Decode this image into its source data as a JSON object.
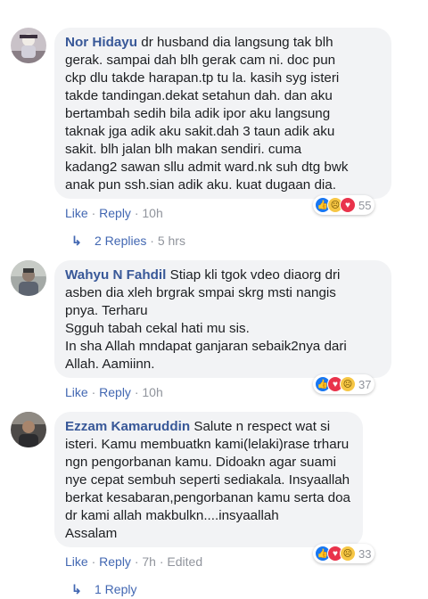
{
  "comments": [
    {
      "author": "Nor Hidayu",
      "lines": [
        "dr husband dia langsung tak blh",
        "gerak. sampai dah blh gerak cam ni. doc pun",
        "ckp dlu takde harapan.tp tu la. kasih syg isteri",
        "takde tandingan.dekat setahun dah. dan aku",
        "bertambah sedih bila adik ipor aku langsung",
        "taknak jga adik aku sakit.dah 3 taun adik aku",
        "sakit. blh jalan blh makan sendiri. cuma",
        "kadang2 sawan sllu admit ward.nk suh dtg bwk",
        "anak pun ssh.sian adik aku. kuat dugaan dia."
      ],
      "actions": {
        "like": "Like",
        "reply": "Reply",
        "time": "10h"
      },
      "reactions": {
        "count": "55",
        "types": [
          "like-icon",
          "sad-icon",
          "love-icon"
        ]
      },
      "replies": {
        "label": "2 Replies",
        "time": "5 hrs"
      }
    },
    {
      "author": "Wahyu N Fahdil",
      "lines": [
        "Stiap kli tgok vdeo diaorg dri",
        "asben dia xleh brgrak smpai skrg msti nangis",
        "pnya. Terharu",
        "Sgguh tabah cekal hati mu sis.",
        "In sha Allah mndapat ganjaran sebaik2nya dari",
        "Allah. Aamiinn."
      ],
      "actions": {
        "like": "Like",
        "reply": "Reply",
        "time": "10h"
      },
      "reactions": {
        "count": "37",
        "types": [
          "like-icon",
          "love-icon",
          "sad-icon"
        ]
      }
    },
    {
      "author": "Ezzam Kamaruddin",
      "lines": [
        "Salute n respect wat si",
        "isteri. Kamu membuatkn kami(lelaki)rase trharu",
        "ngn pengorbanan kamu. Didoakn agar suami",
        "nye cepat sembuh seperti sediakala. Insyaallah",
        "berkat kesabaran,pengorbanan kamu serta doa",
        "dr kami allah makbulkn....insyaallah",
        "Assalam"
      ],
      "actions": {
        "like": "Like",
        "reply": "Reply",
        "time": "7h",
        "edited": "Edited"
      },
      "reactions": {
        "count": "33",
        "types": [
          "like-icon",
          "love-icon",
          "sad-icon"
        ]
      },
      "replies": {
        "label": "1 Reply"
      }
    }
  ],
  "colors": {
    "link": "#4267b2",
    "author": "#385898",
    "bubble": "#f2f3f5",
    "meta": "#90949c"
  }
}
